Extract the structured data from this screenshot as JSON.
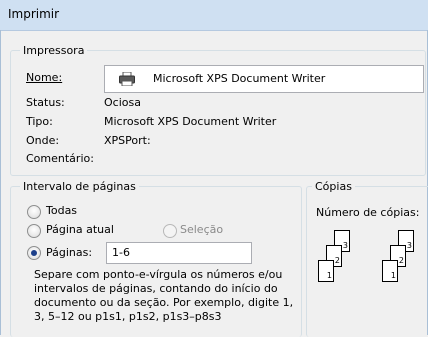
{
  "window": {
    "title": "Imprimir"
  },
  "printer_group": {
    "label": "Impressora",
    "name_label": "Nome:",
    "name_value": "Microsoft XPS Document Writer",
    "status_label": "Status:",
    "status_value": "Ociosa",
    "type_label": "Tipo:",
    "type_value": "Microsoft XPS Document Writer",
    "where_label": "Onde:",
    "where_value": "XPSPort:",
    "comment_label": "Comentário:"
  },
  "range_group": {
    "label": "Intervalo de páginas",
    "all_label": "Todas",
    "current_label": "Página atual",
    "selection_label": "Seleção",
    "pages_label": "Páginas:",
    "pages_value": "1-6",
    "help_text": "Separe com ponto-e-vírgula os números e/ou intervalos de páginas, contando do início do documento ou da seção. Por exemplo, digite 1, 3, 5–12 ou p1s1, p1s2, p1s3–p8s3",
    "selected": "pages"
  },
  "copies_group": {
    "label": "Cópias",
    "count_label": "Número de cópias:",
    "page_numbers": [
      "1",
      "2",
      "3"
    ]
  }
}
